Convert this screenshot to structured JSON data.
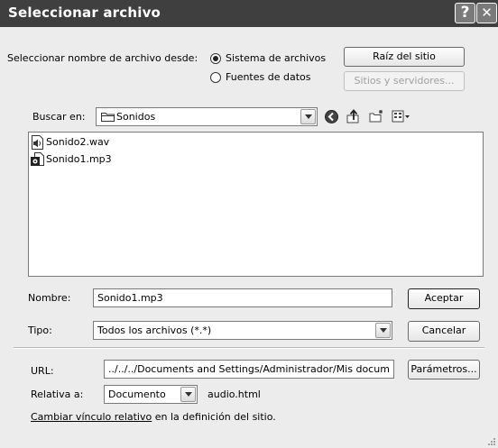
{
  "window": {
    "title": "Seleccionar archivo",
    "help_glyph": "?",
    "close_glyph": "✕"
  },
  "source": {
    "label": "Seleccionar nombre de archivo desde:",
    "option_files": "Sistema de archivos",
    "option_data": "Fuentes de datos",
    "selected": "Sistema de archivos",
    "site_root_button": "Raíz del sitio",
    "servers_button": "Sitios y servidores..."
  },
  "lookin": {
    "label": "Buscar en:",
    "value": "Sonidos"
  },
  "files": [
    {
      "name": "Sonido2.wav",
      "icon": "wav-file-icon"
    },
    {
      "name": "Sonido1.mp3",
      "icon": "mp3-file-icon"
    }
  ],
  "filename": {
    "label": "Nombre:",
    "value": "Sonido1.mp3",
    "accept_button": "Aceptar"
  },
  "filetype": {
    "label": "Tipo:",
    "value": "Todos los archivos (*.*)",
    "cancel_button": "Cancelar"
  },
  "url": {
    "label": "URL:",
    "value": "../../../Documents and Settings/Administrador/Mis docum",
    "params_button": "Parámetros..."
  },
  "relative": {
    "label": "Relativa a:",
    "value": "Documento",
    "doc_name": "audio.html"
  },
  "footer": {
    "link": "Cambiar vínculo relativo",
    "text": " en la definición del sitio."
  }
}
